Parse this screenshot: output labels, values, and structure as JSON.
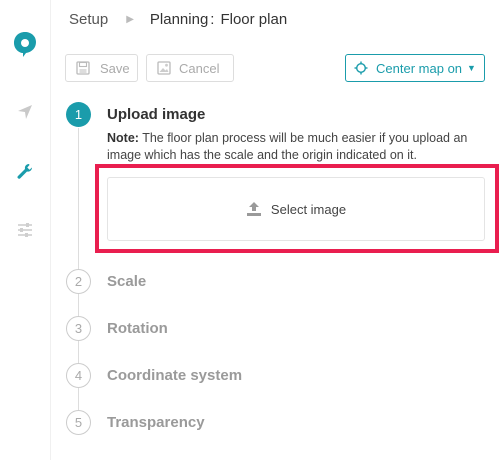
{
  "breadcrumb": {
    "root": "Setup",
    "section": "Planning",
    "separator": ":",
    "page": "Floor plan"
  },
  "toolbar": {
    "save_label": "Save",
    "cancel_label": "Cancel",
    "center_map_label": "Center map on"
  },
  "steps": [
    {
      "number": "1",
      "title": "Upload image",
      "active": true
    },
    {
      "number": "2",
      "title": "Scale",
      "active": false
    },
    {
      "number": "3",
      "title": "Rotation",
      "active": false
    },
    {
      "number": "4",
      "title": "Coordinate system",
      "active": false
    },
    {
      "number": "5",
      "title": "Transparency",
      "active": false
    }
  ],
  "note": {
    "label": "Note:",
    "text": " The floor plan process will be much easier if you upload an image which has the scale and the origin indicated on it."
  },
  "upload": {
    "select_label": "Select image"
  },
  "colors": {
    "accent": "#1a9cab",
    "highlight": "#e91e4f"
  },
  "sidebar_icons": [
    "logo-icon",
    "navigation-icon",
    "wrench-icon",
    "sliders-icon"
  ]
}
